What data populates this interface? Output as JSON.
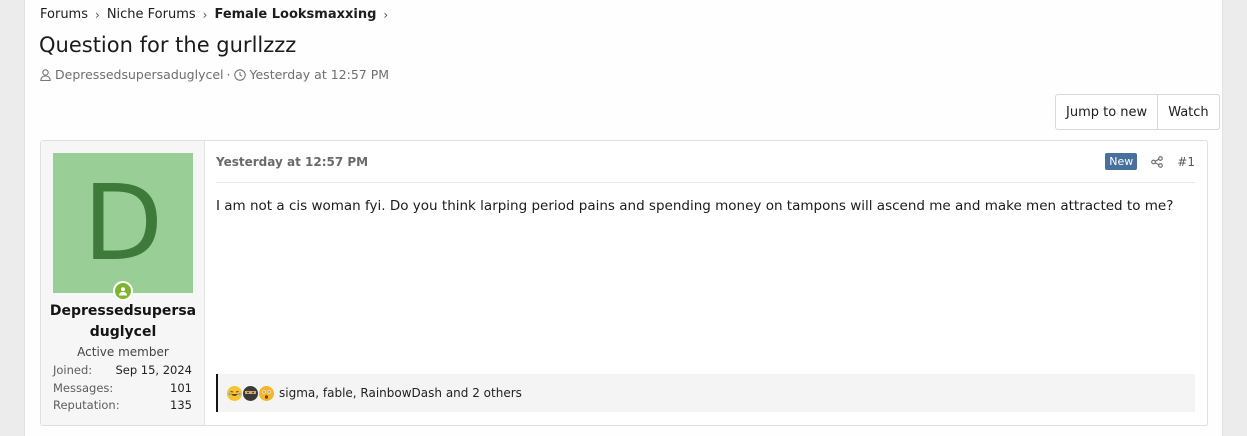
{
  "breadcrumb": {
    "items": [
      "Forums",
      "Niche Forums",
      "Female Looksmaxxing"
    ]
  },
  "thread": {
    "title": "Question for the gurllzzz",
    "author": "Depressedsupersaduglycel",
    "date": "Yesterday at 12:57 PM"
  },
  "actions": {
    "jump_to_new": "Jump to new",
    "watch": "Watch"
  },
  "post": {
    "user": {
      "avatar_letter": "D",
      "name": "Depressedsupersaduglycel",
      "title": "Active member",
      "stats": [
        {
          "label": "Joined:",
          "value": "Sep 15, 2024"
        },
        {
          "label": "Messages:",
          "value": "101"
        },
        {
          "label": "Reputation:",
          "value": "135"
        }
      ]
    },
    "date": "Yesterday at 12:57 PM",
    "new_badge": "New",
    "post_number": "#1",
    "body": "I am not a cis woman fyi. Do you think larping period pains and spending money on tampons will ascend me and make men attracted to me?",
    "reactions_text": "sigma, fable, RainbowDash and 2 others",
    "reaction_icons": [
      "laugh-emoji-icon",
      "ninja-emoji-icon",
      "shocked-emoji-icon"
    ]
  },
  "colors": {
    "avatar_bg": "#99cf97",
    "avatar_fg": "#3e7b3a",
    "online": "#7db52e",
    "new_badge": "#47709d"
  }
}
